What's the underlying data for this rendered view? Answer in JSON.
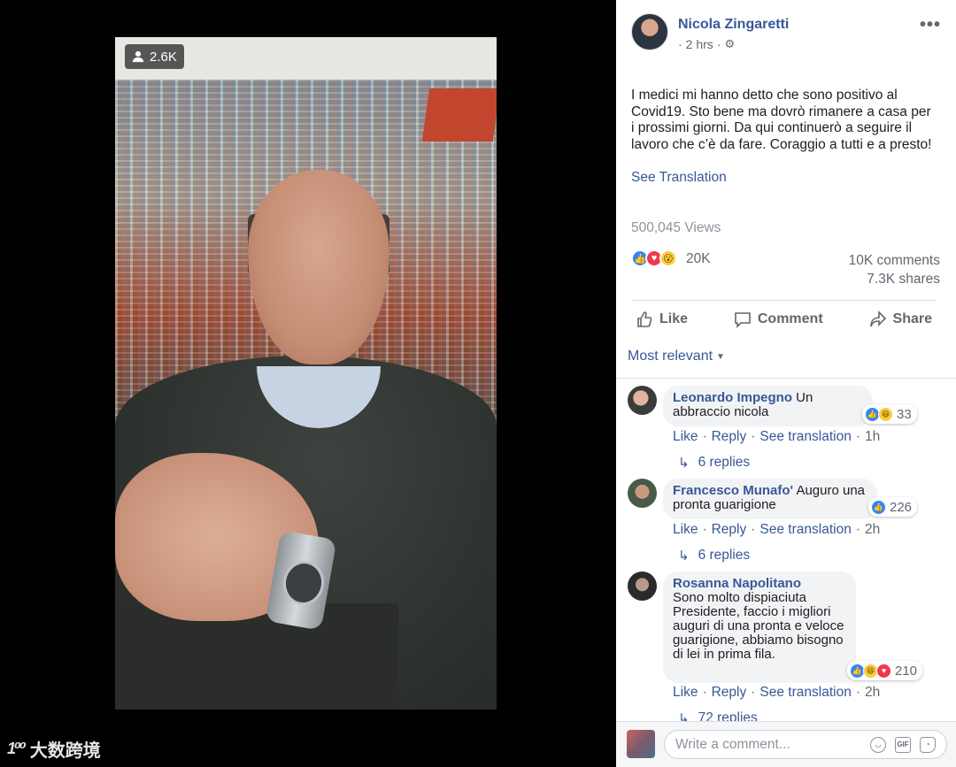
{
  "video": {
    "viewer_count": "2.6K"
  },
  "watermark": {
    "logo": "1⁰⁰",
    "text": "大数跨境"
  },
  "post": {
    "author": "Nicola Zingaretti",
    "time": "2 hrs",
    "more_label": "•••",
    "text": "I medici mi hanno detto che sono positivo al Covid19. Sto bene ma dovrò rimanere a casa per i prossimi giorni. Da qui continuerò a seguire il lavoro che c’è da fare. Coraggio a tutti e a presto!",
    "see_translation": "See Translation",
    "views": "500,045 Views",
    "reaction_count": "20K",
    "comments_count": "10K comments",
    "shares_count": "7.3K shares"
  },
  "actions": {
    "like": "Like",
    "comment": "Comment",
    "share": "Share"
  },
  "sort_label": "Most relevant",
  "comments": [
    {
      "name": "Leonardo Impegno",
      "text": "Un abbraccio nicola",
      "reactions": "33",
      "like": "Like",
      "reply": "Reply",
      "see_translation": "See translation",
      "time": "1h",
      "replies": "6 replies"
    },
    {
      "name": "Francesco Munafo'",
      "text": "Auguro una pronta guarigione",
      "reactions": "226",
      "like": "Like",
      "reply": "Reply",
      "see_translation": "See translation",
      "time": "2h",
      "replies": "6 replies"
    },
    {
      "name": "Rosanna Napolitano",
      "text": "Sono molto dispiaciuta Presidente, faccio i migliori auguri di una pronta e veloce guarigione, abbiamo bisogno di lei in prima fila.",
      "reactions": "210",
      "like": "Like",
      "reply": "Reply",
      "see_translation": "See translation",
      "time": "2h",
      "replies": "72 replies"
    }
  ],
  "composer": {
    "placeholder": "Write a comment..."
  },
  "colors": {
    "link_blue": "#385898",
    "like_blue": "#2d86ff",
    "love_red": "#f0364c",
    "wow_yellow": "#fbcd3b"
  }
}
